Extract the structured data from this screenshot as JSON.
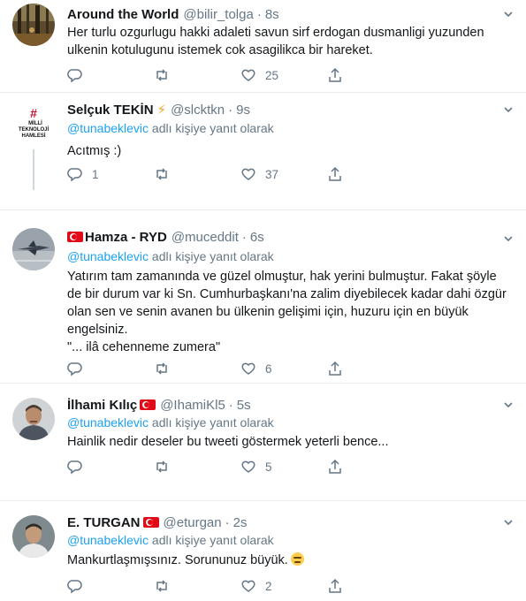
{
  "tweets": [
    {
      "name": "Around the World",
      "handle": "@bilir_tolga",
      "time": "8s",
      "replying_to": "",
      "text_lines": [
        "Her turlu ozgurlugu hakki adaleti savun sirf erdogan dusmanligi yuzunden",
        "ulkenin kotulugunu istemek cok asagilikca bir hareket."
      ],
      "replies": "",
      "retweets": "",
      "likes": "25",
      "avatar_icon": "forest-photo-avatar"
    },
    {
      "name": "Selçuk TEKİN",
      "handle": "@slcktkn",
      "time": "9s",
      "badge_icon": "lightning-icon",
      "replying_to": "@tunabeklevic",
      "replying_suffix": " adlı kişiye yanıt olarak",
      "text_lines": [
        "Acıtmış :)"
      ],
      "replies": "1",
      "retweets": "",
      "likes": "37",
      "avatar_icon": "milli-teknoloji-logo-avatar",
      "avatar_text": [
        "#",
        "MİLLİ",
        "TEKNOLOJİ",
        "HAMLESİ"
      ]
    },
    {
      "name": "Hamza - RYD",
      "handle": "@muceddit",
      "time": "6s",
      "flag_icon": "turkey-flag-icon",
      "replying_to": "@tunabeklevic",
      "replying_suffix": " adlı kişiye yanıt olarak",
      "text_lines": [
        "Yatırım tam zamanında ve güzel olmuştur, hak yerini bulmuştur. Fakat şöyle",
        "de bir durum var ki Sn. Cumhurbaşkanı'na zalim diyebilecek kadar dahi özgür",
        "olan sen ve senin avanen bu ülkenin gelişimi için, huzuru için en büyük",
        "engelsiniz.",
        "\"... ilâ cehenneme zumera\""
      ],
      "replies": "",
      "retweets": "",
      "likes": "6",
      "avatar_icon": "jet-photo-avatar"
    },
    {
      "name": "İlhami Kılıç",
      "handle": "@IhamiKl5",
      "time": "5s",
      "flag_icon": "turkey-flag-icon",
      "replying_to": "@tunabeklevic",
      "replying_suffix": " adlı kişiye yanıt olarak",
      "text_lines": [
        "Hainlik nedir deseler bu tweeti göstermek yeterli bence..."
      ],
      "replies": "",
      "retweets": "",
      "likes": "5",
      "avatar_icon": "man-photo-avatar"
    },
    {
      "name": "E. TURGAN",
      "handle": "@eturgan",
      "time": "2s",
      "flag_icon": "turkey-flag-icon",
      "replying_to": "@tunabeklevic",
      "replying_suffix": " adlı kişiye yanıt olarak",
      "text_lines": [
        "Mankurtlaşmışsınız. Sorununuz büyük."
      ],
      "emoji_icon": "frustrated-face-emoji",
      "replies": "",
      "retweets": "",
      "likes": "2",
      "avatar_icon": "man-photo-avatar"
    }
  ],
  "colors": {
    "link": "#1da1f2",
    "muted": "#657786",
    "text": "#14171a",
    "divider": "#e6ecf0",
    "flag": "#e30a17"
  }
}
